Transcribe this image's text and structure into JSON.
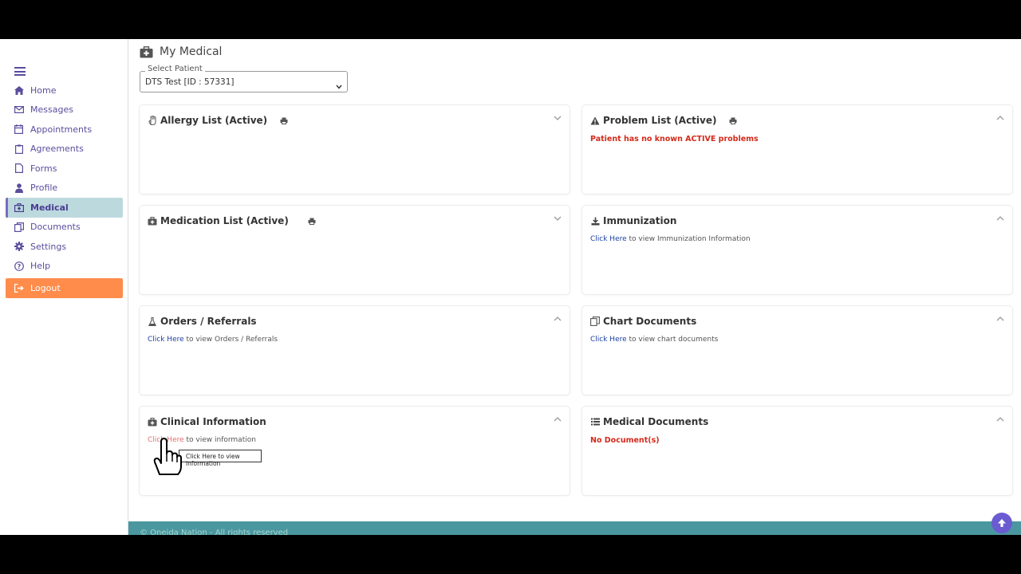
{
  "sidebar": {
    "items": [
      {
        "label": "Home",
        "icon": "home-icon"
      },
      {
        "label": "Messages",
        "icon": "envelope-icon"
      },
      {
        "label": "Appointments",
        "icon": "calendar-icon"
      },
      {
        "label": "Agreements",
        "icon": "clipboard-icon"
      },
      {
        "label": "Forms",
        "icon": "file-icon"
      },
      {
        "label": "Profile",
        "icon": "user-icon"
      },
      {
        "label": "Medical",
        "icon": "medkit-icon"
      },
      {
        "label": "Documents",
        "icon": "copy-icon"
      },
      {
        "label": "Settings",
        "icon": "gear-icon"
      },
      {
        "label": "Help",
        "icon": "question-icon"
      },
      {
        "label": "Logout",
        "icon": "sign-out-icon"
      }
    ]
  },
  "header": {
    "title": "My Medical",
    "select_label": "Select Patient",
    "select_value": "DTS Test [ID : 57331]"
  },
  "cards": {
    "allergy": {
      "title": "Allergy List (Active)"
    },
    "problem": {
      "title": "Problem List (Active)",
      "message": "Patient has no known ACTIVE problems"
    },
    "medication": {
      "title": "Medication List (Active)"
    },
    "immunization": {
      "title": "Immunization",
      "link": "Click Here",
      "text": " to view Immunization Information"
    },
    "orders": {
      "title": "Orders / Referrals",
      "link": "Click Here",
      "text": " to view Orders / Referrals"
    },
    "chart_docs": {
      "title": "Chart Documents",
      "link": "Click Here",
      "text": " to view chart documents"
    },
    "clinical": {
      "title": "Clinical Information",
      "link": "Click Here",
      "text": " to view information"
    },
    "medical_docs": {
      "title": "Medical Documents",
      "message": "No Document(s)"
    }
  },
  "tooltip": "Click Here to view information",
  "footer": "© Oneida Nation - All rights reserved",
  "colors": {
    "accent": "#5b4d9c",
    "active_bg": "#bcd9de",
    "logout": "#ff8c4b",
    "alert": "#d42a1a",
    "footer": "#4a97a0",
    "scroll_btn": "#6b5bd1"
  }
}
